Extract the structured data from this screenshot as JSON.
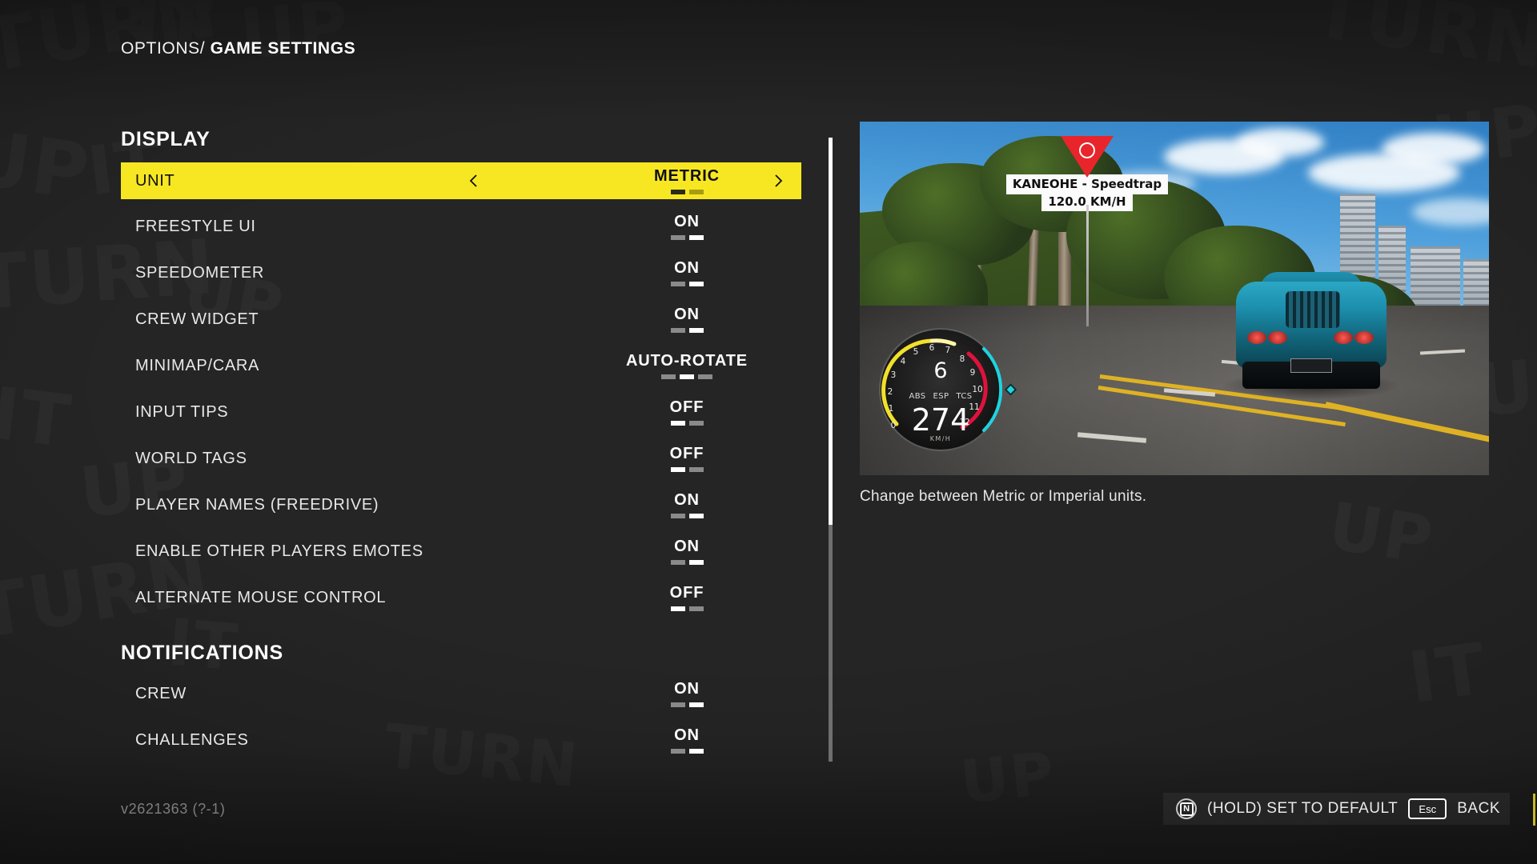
{
  "breadcrumb": {
    "parent": "OPTIONS",
    "separator": "/",
    "current": "GAME SETTINGS"
  },
  "sections": [
    {
      "title": "DISPLAY",
      "rows": [
        {
          "label": "UNIT",
          "value": "METRIC",
          "segments": 2,
          "active_index": 0,
          "selected": true,
          "left_arrow": "chevron-left-icon",
          "right_arrow": "chevron-right-icon"
        },
        {
          "label": "FREESTYLE UI",
          "value": "ON",
          "segments": 2,
          "active_index": 1,
          "selected": false
        },
        {
          "label": "SPEEDOMETER",
          "value": "ON",
          "segments": 2,
          "active_index": 1,
          "selected": false
        },
        {
          "label": "CREW WIDGET",
          "value": "ON",
          "segments": 2,
          "active_index": 1,
          "selected": false
        },
        {
          "label": "MINIMAP/CARA",
          "value": "AUTO-ROTATE",
          "segments": 3,
          "active_index": 1,
          "selected": false
        },
        {
          "label": "INPUT TIPS",
          "value": "OFF",
          "segments": 2,
          "active_index": 0,
          "selected": false
        },
        {
          "label": "WORLD TAGS",
          "value": "OFF",
          "segments": 2,
          "active_index": 0,
          "selected": false
        },
        {
          "label": "PLAYER NAMES (FREEDRIVE)",
          "value": "ON",
          "segments": 2,
          "active_index": 1,
          "selected": false
        },
        {
          "label": "ENABLE OTHER PLAYERS EMOTES",
          "value": "ON",
          "segments": 2,
          "active_index": 1,
          "selected": false
        },
        {
          "label": "ALTERNATE MOUSE CONTROL",
          "value": "OFF",
          "segments": 2,
          "active_index": 0,
          "selected": false
        }
      ]
    },
    {
      "title": "NOTIFICATIONS",
      "rows": [
        {
          "label": "CREW",
          "value": "ON",
          "segments": 2,
          "active_index": 1,
          "selected": false
        },
        {
          "label": "CHALLENGES",
          "value": "ON",
          "segments": 2,
          "active_index": 1,
          "selected": false
        }
      ]
    }
  ],
  "preview": {
    "marker": {
      "title": "KANEOHE - Speedtrap",
      "speed": "120.0 KM/H",
      "icon": "speedtrap-marker-icon"
    },
    "hud": {
      "gear": "6",
      "speed": "274",
      "unit": "KM/H",
      "aids": [
        "ABS",
        "ESP",
        "TCS"
      ],
      "ticks": [
        "0",
        "1",
        "2",
        "3",
        "4",
        "5",
        "6",
        "7",
        "8",
        "9",
        "10",
        "11",
        "12"
      ]
    }
  },
  "description": "Change between Metric or Imperial units.",
  "footer": {
    "version": "v2621363 (?-1)",
    "default_key": "N",
    "default_label": "(HOLD) SET TO DEFAULT",
    "back_key": "Esc",
    "back_label": "BACK"
  },
  "background_text": [
    "TURN",
    "IT",
    "UP",
    "TURN",
    "IT",
    "UP",
    "TURN",
    "IT",
    "UP"
  ],
  "colors": {
    "accent_yellow": "#f7e722",
    "panel_bg": "#252525",
    "text_primary": "#ffffff",
    "marker_red": "#e8252b",
    "hud_cyan": "#1fd3e0"
  }
}
